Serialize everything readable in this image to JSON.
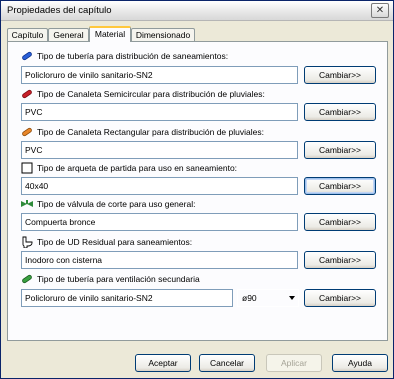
{
  "window": {
    "title": "Propiedades del capítulo",
    "close_glyph": "✕"
  },
  "tabs": [
    {
      "label": "Capítulo",
      "active": false
    },
    {
      "label": "General",
      "active": false
    },
    {
      "label": "Material",
      "active": true
    },
    {
      "label": "Dimensionado",
      "active": false
    }
  ],
  "groups": [
    {
      "icon": "blue-pipe-icon",
      "label": "Tipo de tubería para distribución de saneamientos:",
      "value": "Policloruro de vinilo sanitario-SN2",
      "button": "Cambiar>>"
    },
    {
      "icon": "red-gutter-icon",
      "label": "Tipo de Canaleta Semicircular para distribución de pluviales:",
      "value": "PVC",
      "button": "Cambiar>>"
    },
    {
      "icon": "orange-gutter-icon",
      "label": "Tipo de Canaleta Rectangular para distribución de pluviales:",
      "value": "PVC",
      "button": "Cambiar>>"
    },
    {
      "icon": "square-box-icon",
      "label": "Tipo de arqueta de partida para uso en saneamiento:",
      "value": "40x40",
      "button": "Cambiar>>"
    },
    {
      "icon": "valve-icon",
      "label": "Tipo de válvula de corte para uso general:",
      "value": "Compuerta bronce",
      "button": "Cambiar>>"
    },
    {
      "icon": "toilet-icon",
      "label": "Tipo de UD Residual para saneamientos:",
      "value": "Inodoro con cisterna",
      "button": "Cambiar>>"
    },
    {
      "icon": "green-pipe-icon",
      "label": "Tipo de tubería para ventilación secundaria",
      "value": "Policloruro de vinilo sanitario-SN2",
      "button": "Cambiar>>",
      "diameter": "ø90"
    }
  ],
  "footer": {
    "accept": "Aceptar",
    "cancel": "Cancelar",
    "apply": "Aplicar",
    "help": "Ayuda"
  },
  "colors": {
    "pipe_blue": "#2a5fd8",
    "gutter_red": "#c8202a",
    "gutter_orange": "#e8862a",
    "valve_green": "#2e8b3a",
    "vent_green": "#3aa040"
  }
}
